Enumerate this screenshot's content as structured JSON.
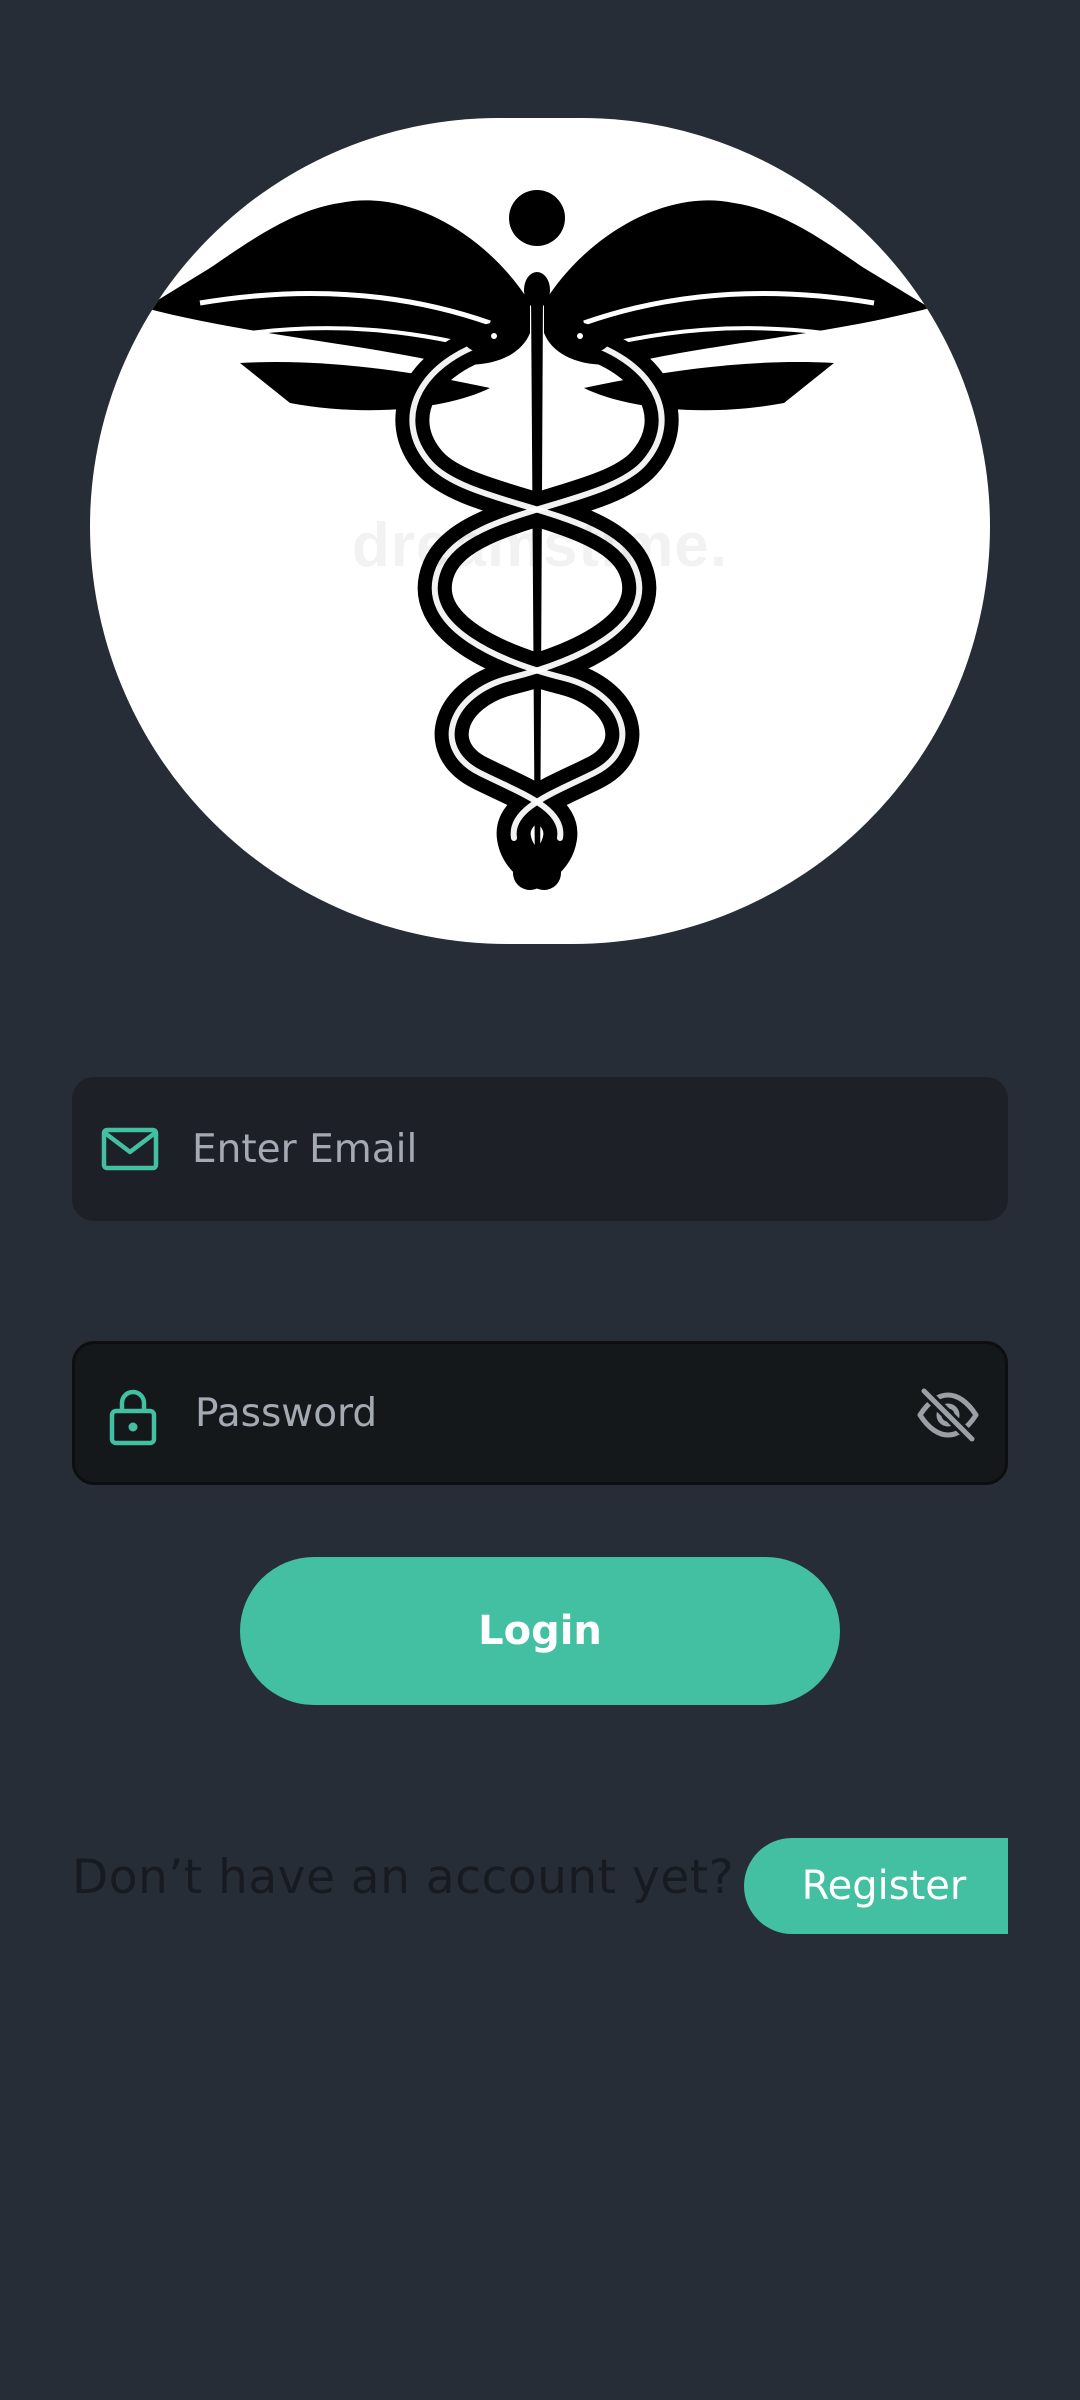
{
  "logo": {
    "icon": "caduceus-icon",
    "watermark": "dreamstime."
  },
  "email_field": {
    "placeholder": "Enter Email",
    "value": "",
    "icon": "mail-icon"
  },
  "password_field": {
    "placeholder": "Password",
    "value": "",
    "icon": "lock-icon",
    "toggle_icon": "eye-off-icon"
  },
  "login_button": {
    "label": "Login"
  },
  "register": {
    "prompt": "Don’t have an account yet?",
    "button_label": "Register"
  },
  "colors": {
    "background": "#272d36",
    "accent": "#43bfa2",
    "field_bg": "#1d2127",
    "placeholder": "#a3aab3"
  }
}
